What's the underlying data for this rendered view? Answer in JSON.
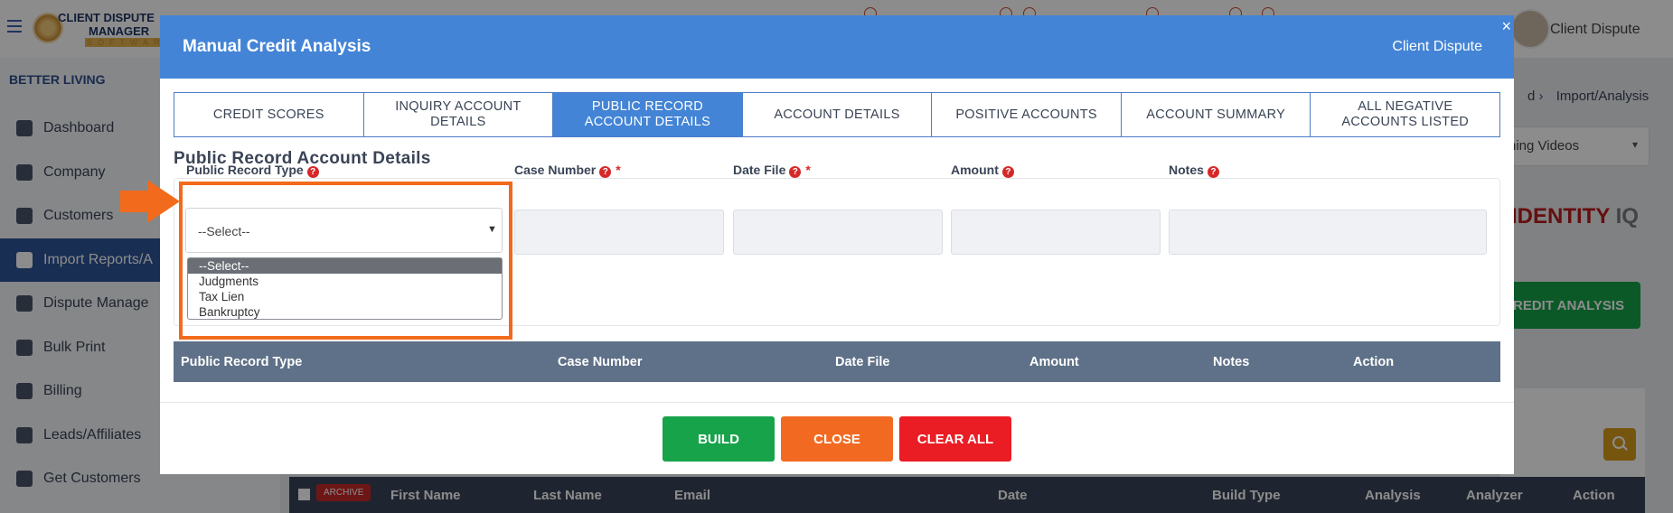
{
  "background": {
    "logo": {
      "line1": "CLIENT DISPUTE",
      "line2": "MANAGER",
      "line3": "SOFTWARE"
    },
    "user_name": "Client Dispute",
    "org_name": "BETTER LIVING",
    "nav": [
      {
        "label": "Dashboard",
        "icon": "dashboard-icon"
      },
      {
        "label": "Company",
        "icon": "building-icon"
      },
      {
        "label": "Customers",
        "icon": "users-icon"
      },
      {
        "label": "Import Reports/A",
        "icon": "file-import-icon"
      },
      {
        "label": "Dispute Manage",
        "icon": "laptop-icon"
      },
      {
        "label": "Bulk Print",
        "icon": "printer-icon"
      },
      {
        "label": "Billing",
        "icon": "invoice-icon"
      },
      {
        "label": "Leads/Affiliates",
        "icon": "chart-line-icon"
      },
      {
        "label": "Get Customers",
        "icon": "graduation-cap-icon"
      }
    ],
    "breadcrumb_prefix": "d",
    "breadcrumb_current": "Import/Analysis",
    "videos_select": "ning Videos",
    "identity_brand": "IDENTITY",
    "identity_iq": "IQ",
    "credit_analysis_button": "REDIT ANALYSIS",
    "table_headers": {
      "archive": "ARCHIVE",
      "first_name": "First Name",
      "last_name": "Last Name",
      "email": "Email",
      "date": "Date",
      "build_type": "Build Type",
      "analysis": "Analysis",
      "analyzer": "Analyzer",
      "action": "Action"
    }
  },
  "modal": {
    "title": "Manual Credit Analysis",
    "client": "Client Dispute",
    "close_glyph": "×",
    "tabs": [
      {
        "label": "CREDIT SCORES",
        "active": false
      },
      {
        "label": "INQUIRY ACCOUNT DETAILS",
        "active": false
      },
      {
        "label": "PUBLIC RECORD ACCOUNT DETAILS",
        "active": true
      },
      {
        "label": "ACCOUNT DETAILS",
        "active": false
      },
      {
        "label": "POSITIVE ACCOUNTS",
        "active": false
      },
      {
        "label": "ACCOUNT SUMMARY",
        "active": false
      },
      {
        "label": "ALL NEGATIVE ACCOUNTS LISTED",
        "active": false
      }
    ],
    "section_title": "Public Record Account Details",
    "fields": {
      "public_record_type": {
        "label": "Public Record Type",
        "value": "--Select--"
      },
      "case_number": {
        "label": "Case Number",
        "required": "*",
        "value": ""
      },
      "date_file": {
        "label": "Date File",
        "required": "*",
        "value": ""
      },
      "amount": {
        "label": "Amount",
        "value": ""
      },
      "notes": {
        "label": "Notes",
        "value": ""
      }
    },
    "help_glyph": "?",
    "dropdown_options": [
      "--Select--",
      "Judgments",
      "Tax Lien",
      "Bankruptcy"
    ],
    "table_headers": {
      "public_record_type": "Public Record Type",
      "case_number": "Case Number",
      "date_file": "Date File",
      "amount": "Amount",
      "notes": "Notes",
      "action": "Action"
    },
    "buttons": {
      "build": "BUILD",
      "close": "CLOSE",
      "clear_all": "CLEAR ALL"
    }
  },
  "colors": {
    "header_blue": "#4384d6",
    "highlight_orange": "#f26a1b",
    "build_green": "#16a34a",
    "clear_red": "#ea1c24"
  }
}
